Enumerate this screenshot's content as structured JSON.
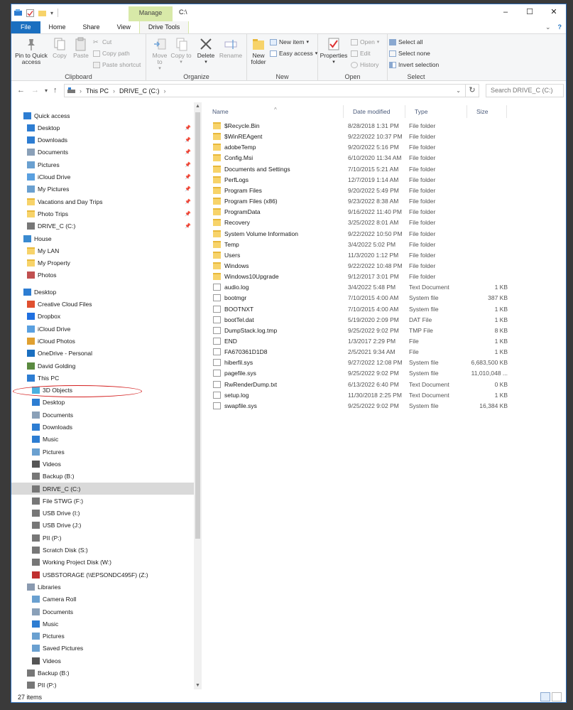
{
  "titlebar": {
    "manage": "Manage",
    "title": "C:\\",
    "minimize": "–",
    "maximize": "☐",
    "close": "✕"
  },
  "tabs": [
    "File",
    "Home",
    "Share",
    "View",
    "Drive Tools"
  ],
  "tabs_right": {
    "collapse": "⌄",
    "help": "?"
  },
  "ribbon": {
    "clipboard": {
      "label": "Clipboard",
      "pin": "Pin to Quick access",
      "copy": "Copy",
      "paste": "Paste",
      "cut": "Cut",
      "copy_path": "Copy path",
      "paste_shortcut": "Paste shortcut"
    },
    "organize": {
      "label": "Organize",
      "move_to": "Move to",
      "copy_to": "Copy to",
      "delete": "Delete",
      "rename": "Rename"
    },
    "new": {
      "label": "New",
      "new_folder": "New folder",
      "new_item": "New item",
      "easy_access": "Easy access"
    },
    "open": {
      "label": "Open",
      "properties": "Properties",
      "open": "Open",
      "edit": "Edit",
      "history": "History"
    },
    "select": {
      "label": "Select",
      "select_all": "Select all",
      "select_none": "Select none",
      "invert": "Invert selection"
    }
  },
  "address": {
    "crumbs": [
      "This PC",
      "DRIVE_C (C:)"
    ],
    "search_placeholder": "Search DRIVE_C (C:)"
  },
  "nav": [
    {
      "label": "Quick access",
      "level": 0,
      "icon": "star-icon",
      "pinned": false
    },
    {
      "label": "Desktop",
      "level": 1,
      "icon": "desktop-icon",
      "pinned": true
    },
    {
      "label": "Downloads",
      "level": 1,
      "icon": "download-icon",
      "pinned": true
    },
    {
      "label": "Documents",
      "level": 1,
      "icon": "documents-icon",
      "pinned": true
    },
    {
      "label": "Pictures",
      "level": 1,
      "icon": "pictures-icon",
      "pinned": true
    },
    {
      "label": "iCloud Drive",
      "level": 1,
      "icon": "icloud-icon",
      "pinned": true
    },
    {
      "label": "My Pictures",
      "level": 1,
      "icon": "pictures-icon",
      "pinned": true
    },
    {
      "label": "Vacations and Day Trips",
      "level": 1,
      "icon": "folder-icon",
      "pinned": true
    },
    {
      "label": "Photo Trips",
      "level": 1,
      "icon": "folder-icon",
      "pinned": true
    },
    {
      "label": "DRIVE_C (C:)",
      "level": 1,
      "icon": "drive-icon",
      "pinned": true
    },
    {
      "label": "House",
      "level": 0,
      "icon": "homegroup-icon",
      "pinned": false
    },
    {
      "label": "My LAN",
      "level": 1,
      "icon": "folder-icon",
      "pinned": false
    },
    {
      "label": "My Property",
      "level": 1,
      "icon": "folder-icon",
      "pinned": false
    },
    {
      "label": "Photos",
      "level": 1,
      "icon": "photos-icon",
      "pinned": false
    },
    {
      "label": "Desktop",
      "level": 0,
      "icon": "desktop-icon",
      "pinned": false,
      "gap": true
    },
    {
      "label": "Creative Cloud Files",
      "level": 1,
      "icon": "creative-cloud-icon",
      "pinned": false
    },
    {
      "label": "Dropbox",
      "level": 1,
      "icon": "dropbox-icon",
      "pinned": false
    },
    {
      "label": "iCloud Drive",
      "level": 1,
      "icon": "icloud-icon",
      "pinned": false
    },
    {
      "label": "iCloud Photos",
      "level": 1,
      "icon": "icloud-photos-icon",
      "pinned": false
    },
    {
      "label": "OneDrive - Personal",
      "level": 1,
      "icon": "onedrive-icon",
      "pinned": false
    },
    {
      "label": "David Golding",
      "level": 1,
      "icon": "user-icon",
      "pinned": false
    },
    {
      "label": "This PC",
      "level": 1,
      "icon": "pc-icon",
      "pinned": false
    },
    {
      "label": "3D Objects",
      "level": 2,
      "icon": "3d-objects-icon",
      "pinned": false
    },
    {
      "label": "Desktop",
      "level": 2,
      "icon": "desktop-icon",
      "pinned": false
    },
    {
      "label": "Documents",
      "level": 2,
      "icon": "documents-icon",
      "pinned": false
    },
    {
      "label": "Downloads",
      "level": 2,
      "icon": "download-icon",
      "pinned": false
    },
    {
      "label": "Music",
      "level": 2,
      "icon": "music-icon",
      "pinned": false
    },
    {
      "label": "Pictures",
      "level": 2,
      "icon": "pictures-icon",
      "pinned": false
    },
    {
      "label": "Videos",
      "level": 2,
      "icon": "videos-icon",
      "pinned": false
    },
    {
      "label": "Backup (B:)",
      "level": 2,
      "icon": "drive-icon",
      "pinned": false
    },
    {
      "label": "DRIVE_C (C:)",
      "level": 2,
      "icon": "drive-icon",
      "pinned": false,
      "selected": true
    },
    {
      "label": "File STWG (F:)",
      "level": 2,
      "icon": "drive-icon",
      "pinned": false
    },
    {
      "label": "USB Drive (I:)",
      "level": 2,
      "icon": "drive-icon",
      "pinned": false
    },
    {
      "label": "USB Drive (J:)",
      "level": 2,
      "icon": "drive-icon",
      "pinned": false
    },
    {
      "label": "PII (P:)",
      "level": 2,
      "icon": "drive-icon",
      "pinned": false
    },
    {
      "label": "Scratch Disk (S:)",
      "level": 2,
      "icon": "drive-icon",
      "pinned": false
    },
    {
      "label": "Working Project Disk (W:)",
      "level": 2,
      "icon": "drive-icon",
      "pinned": false
    },
    {
      "label": "USBSTORAGE (\\\\EPSONDC495F) (Z:)",
      "level": 2,
      "icon": "network-drive-icon",
      "pinned": false
    },
    {
      "label": "Libraries",
      "level": 1,
      "icon": "libraries-icon",
      "pinned": false
    },
    {
      "label": "Camera Roll",
      "level": 2,
      "icon": "pictures-icon",
      "pinned": false
    },
    {
      "label": "Documents",
      "level": 2,
      "icon": "documents-icon",
      "pinned": false
    },
    {
      "label": "Music",
      "level": 2,
      "icon": "music-icon",
      "pinned": false
    },
    {
      "label": "Pictures",
      "level": 2,
      "icon": "pictures-icon",
      "pinned": false
    },
    {
      "label": "Saved Pictures",
      "level": 2,
      "icon": "pictures-icon",
      "pinned": false
    },
    {
      "label": "Videos",
      "level": 2,
      "icon": "videos-icon",
      "pinned": false
    },
    {
      "label": "Backup (B:)",
      "level": 1,
      "icon": "drive-icon",
      "pinned": false
    },
    {
      "label": "PII (P:)",
      "level": 1,
      "icon": "drive-icon",
      "pinned": false
    }
  ],
  "columns": {
    "name": "Name",
    "date": "Date modified",
    "type": "Type",
    "size": "Size"
  },
  "files": [
    {
      "name": "$Recycle.Bin",
      "date": "8/28/2018 1:31 PM",
      "type": "File folder",
      "size": "",
      "kind": "folder"
    },
    {
      "name": "$WinREAgent",
      "date": "9/22/2022 10:37 PM",
      "type": "File folder",
      "size": "",
      "kind": "folder"
    },
    {
      "name": "adobeTemp",
      "date": "9/20/2022 5:16 PM",
      "type": "File folder",
      "size": "",
      "kind": "folder"
    },
    {
      "name": "Config.Msi",
      "date": "6/10/2020 11:34 AM",
      "type": "File folder",
      "size": "",
      "kind": "folder"
    },
    {
      "name": "Documents and Settings",
      "date": "7/10/2015 5:21 AM",
      "type": "File folder",
      "size": "",
      "kind": "folder"
    },
    {
      "name": "PerfLogs",
      "date": "12/7/2019 1:14 AM",
      "type": "File folder",
      "size": "",
      "kind": "folder"
    },
    {
      "name": "Program Files",
      "date": "9/20/2022 5:49 PM",
      "type": "File folder",
      "size": "",
      "kind": "folder"
    },
    {
      "name": "Program Files (x86)",
      "date": "9/23/2022 8:38 AM",
      "type": "File folder",
      "size": "",
      "kind": "folder"
    },
    {
      "name": "ProgramData",
      "date": "9/16/2022 11:40 PM",
      "type": "File folder",
      "size": "",
      "kind": "folder"
    },
    {
      "name": "Recovery",
      "date": "3/25/2022 8:01 AM",
      "type": "File folder",
      "size": "",
      "kind": "folder"
    },
    {
      "name": "System Volume Information",
      "date": "9/22/2022 10:50 PM",
      "type": "File folder",
      "size": "",
      "kind": "folder"
    },
    {
      "name": "Temp",
      "date": "3/4/2022 5:02 PM",
      "type": "File folder",
      "size": "",
      "kind": "folder"
    },
    {
      "name": "Users",
      "date": "11/3/2020 1:12 PM",
      "type": "File folder",
      "size": "",
      "kind": "folder"
    },
    {
      "name": "Windows",
      "date": "9/22/2022 10:48 PM",
      "type": "File folder",
      "size": "",
      "kind": "folder"
    },
    {
      "name": "Windows10Upgrade",
      "date": "9/12/2017 3:01 PM",
      "type": "File folder",
      "size": "",
      "kind": "folder"
    },
    {
      "name": "audio.log",
      "date": "3/4/2022 5:48 PM",
      "type": "Text Document",
      "size": "1 KB",
      "kind": "file"
    },
    {
      "name": "bootmgr",
      "date": "7/10/2015 4:00 AM",
      "type": "System file",
      "size": "387 KB",
      "kind": "file"
    },
    {
      "name": "BOOTNXT",
      "date": "7/10/2015 4:00 AM",
      "type": "System file",
      "size": "1 KB",
      "kind": "file"
    },
    {
      "name": "bootTel.dat",
      "date": "5/19/2020 2:09 PM",
      "type": "DAT File",
      "size": "1 KB",
      "kind": "file"
    },
    {
      "name": "DumpStack.log.tmp",
      "date": "9/25/2022 9:02 PM",
      "type": "TMP File",
      "size": "8 KB",
      "kind": "file"
    },
    {
      "name": "END",
      "date": "1/3/2017 2:29 PM",
      "type": "File",
      "size": "1 KB",
      "kind": "file"
    },
    {
      "name": "FA670361D1D8",
      "date": "2/5/2021 9:34 AM",
      "type": "File",
      "size": "1 KB",
      "kind": "file"
    },
    {
      "name": "hiberfil.sys",
      "date": "9/27/2022 12:08 PM",
      "type": "System file",
      "size": "6,683,500 KB",
      "kind": "file"
    },
    {
      "name": "pagefile.sys",
      "date": "9/25/2022 9:02 PM",
      "type": "System file",
      "size": "11,010,048 ...",
      "kind": "file"
    },
    {
      "name": "RwRenderDump.txt",
      "date": "6/13/2022 6:40 PM",
      "type": "Text Document",
      "size": "0 KB",
      "kind": "file"
    },
    {
      "name": "setup.log",
      "date": "11/30/2018 2:25 PM",
      "type": "Text Document",
      "size": "1 KB",
      "kind": "file"
    },
    {
      "name": "swapfile.sys",
      "date": "9/25/2022 9:02 PM",
      "type": "System file",
      "size": "16,384 KB",
      "kind": "file"
    }
  ],
  "status": {
    "count": "27 items"
  },
  "colors": {
    "accent": "#1a6fc0",
    "manage_tab": "#d8e9a8",
    "folder": "#f7d36a",
    "annotation": "#d42020"
  }
}
